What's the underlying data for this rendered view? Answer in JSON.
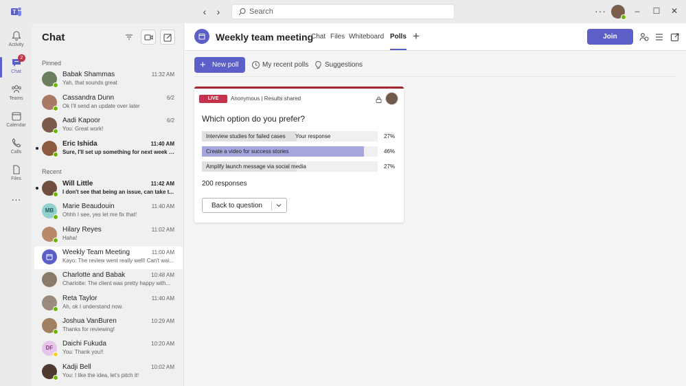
{
  "titlebar": {
    "search_placeholder": "Search",
    "more_label": "···"
  },
  "rail": {
    "items": [
      {
        "label": "Activity",
        "icon": "bell-icon"
      },
      {
        "label": "Chat",
        "icon": "chat-icon",
        "badge": "2"
      },
      {
        "label": "Teams",
        "icon": "teams-icon"
      },
      {
        "label": "Calendar",
        "icon": "calendar-icon"
      },
      {
        "label": "Calls",
        "icon": "phone-icon"
      },
      {
        "label": "Files",
        "icon": "file-icon"
      }
    ],
    "more_label": "···"
  },
  "chat": {
    "title": "Chat",
    "pinned_label": "Pinned",
    "recent_label": "Recent",
    "pinned": [
      {
        "name": "Babak Shammas",
        "time": "11:32 AM",
        "preview": "Yah, that sounds great",
        "unread": false,
        "avatar_color": "#6b7f5e",
        "status": "available"
      },
      {
        "name": "Cassandra Dunn",
        "time": "6/2",
        "preview": "Ok I'll send an update over later",
        "unread": false,
        "avatar_color": "#a87967",
        "status": "available"
      },
      {
        "name": "Aadi Kapoor",
        "time": "6/2",
        "preview": "You: Great work!",
        "unread": false,
        "avatar_color": "#7b5a4a",
        "status": "available"
      },
      {
        "name": "Eric Ishida",
        "time": "11:40 AM",
        "preview": "Sure, I'll set up something for next week to...",
        "unread": true,
        "avatar_color": "#8c5b3e",
        "status": "available"
      }
    ],
    "recent": [
      {
        "name": "Will Little",
        "time": "11:42 AM",
        "preview": "I don't see that being an issue, can take t...",
        "unread": true,
        "avatar_color": "#6f4e3d",
        "status": "available"
      },
      {
        "name": "Marie Beaudouin",
        "initials": "MB",
        "time": "11:40 AM",
        "preview": "Ohhh I see, yes let me fix that!",
        "unread": false,
        "avatar_color": "#92d0cf",
        "initials_color": "#1f5f5e",
        "status": "available"
      },
      {
        "name": "Hilary Reyes",
        "time": "11:02 AM",
        "preview": "Haha!",
        "unread": false,
        "avatar_color": "#b88a6a",
        "status": "available"
      },
      {
        "name": "Weekly Team Meeting",
        "time": "11:00 AM",
        "preview": "Kayo: The review went really well! Can't wai...",
        "unread": false,
        "avatar_color": "#5b5fc7",
        "meeting": true,
        "selected": true
      },
      {
        "name": "Charlotte and Babak",
        "time": "10:48 AM",
        "preview": "Charlotte: The client was pretty happy with...",
        "unread": false,
        "avatar_color": "#8a7a6a",
        "status": "none"
      },
      {
        "name": "Reta Taylor",
        "time": "11:40 AM",
        "preview": "Ah, ok I understand now.",
        "unread": false,
        "avatar_color": "#9a8c7c",
        "status": "available"
      },
      {
        "name": "Joshua VanBuren",
        "time": "10:29 AM",
        "preview": "Thanks for reviewing!",
        "unread": false,
        "avatar_color": "#a08060",
        "status": "available"
      },
      {
        "name": "Daichi Fukuda",
        "initials": "DF",
        "time": "10:20 AM",
        "preview": "You: Thank you!!",
        "unread": false,
        "avatar_color": "#e7c4ea",
        "initials_color": "#8a3a8f",
        "status": "away"
      },
      {
        "name": "Kadji Bell",
        "time": "10:02 AM",
        "preview": "You: I like the idea, let's pitch it!",
        "unread": false,
        "avatar_color": "#4e3a30",
        "status": "available"
      }
    ]
  },
  "main": {
    "title": "Weekly team meeting",
    "tabs": [
      {
        "label": "Chat",
        "active": false
      },
      {
        "label": "Files",
        "active": false
      },
      {
        "label": "Whiteboard",
        "active": false
      },
      {
        "label": "Polls",
        "active": true
      }
    ],
    "add_tab": "+",
    "join_label": "Join"
  },
  "polls": {
    "new_poll_label": "New poll",
    "my_recent_label": "My recent polls",
    "suggestions_label": "Suggestions",
    "card": {
      "live_label": "LIVE",
      "meta": "Anonymous | Results shared",
      "question": "Which option do you prefer?",
      "your_response_label": "Your response",
      "options": [
        {
          "text": "Interview studies for failed cases",
          "percent_label": "27%",
          "percent": 27,
          "mine": false,
          "your_response": true
        },
        {
          "text": "Create a video for success stories",
          "percent_label": "46%",
          "percent": 46,
          "mine": true,
          "your_response": false
        },
        {
          "text": "Amplify launch message via social media",
          "percent_label": "27%",
          "percent": 27,
          "mine": false,
          "your_response": false
        }
      ],
      "responses": "200 responses",
      "back_label": "Back to question"
    }
  },
  "colors": {
    "brand": "#5b5fc7",
    "live": "#c4314b",
    "available": "#6bb700",
    "away": "#f8d22a"
  }
}
